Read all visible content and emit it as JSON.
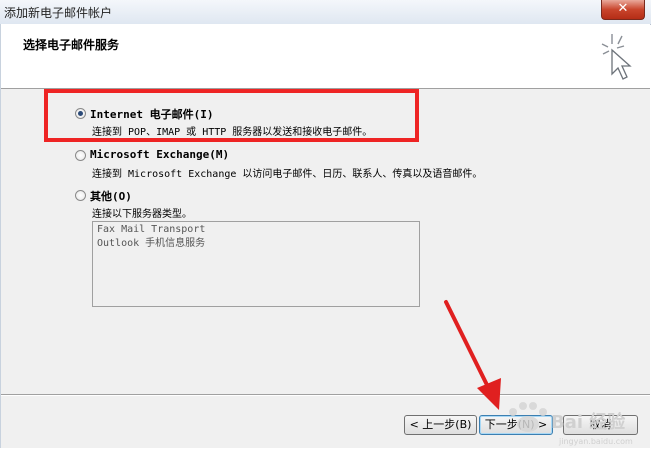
{
  "window": {
    "title": "添加新电子邮件帐户",
    "close_label": "✕"
  },
  "header": {
    "title": "选择电子邮件服务"
  },
  "options": [
    {
      "label": "Internet 电子邮件(I)",
      "description": "连接到 POP、IMAP 或 HTTP 服务器以发送和接收电子邮件。",
      "checked": true
    },
    {
      "label": "Microsoft Exchange(M)",
      "description": "连接到 Microsoft Exchange 以访问电子邮件、日历、联系人、传真以及语音邮件。",
      "checked": false
    },
    {
      "label": "其他(O)",
      "description": "连接以下服务器类型。",
      "checked": false
    }
  ],
  "server_types": [
    "Fax Mail Transport",
    "Outlook 手机信息服务"
  ],
  "buttons": {
    "back": "< 上一步(B)",
    "next": "下一步(N) >",
    "cancel": "取消"
  },
  "watermark": {
    "text": "Bai 经验",
    "sub": "jingyan.baidu.com"
  },
  "colors": {
    "highlight": "#ee2424",
    "arrow": "#e02020"
  }
}
